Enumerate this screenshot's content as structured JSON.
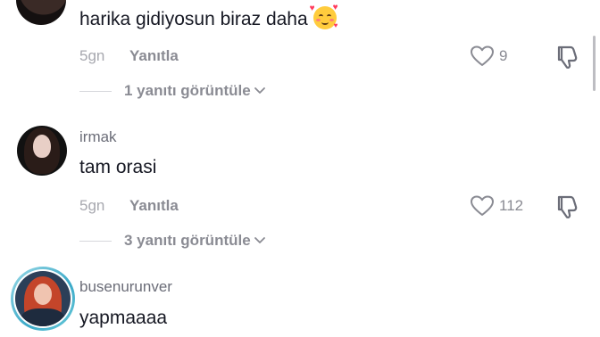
{
  "comments": [
    {
      "text": "harika gidiyosun biraz daha",
      "emoji": "smiling-face-with-hearts",
      "time": "5gn",
      "reply_label": "Yanıtla",
      "likes": "9",
      "view_replies": "1 yanıtı görüntüle"
    },
    {
      "username": "irmak",
      "text": "tam orasi",
      "time": "5gn",
      "reply_label": "Yanıtla",
      "likes": "112",
      "view_replies": "3 yanıtı görüntüle"
    },
    {
      "username": "busenurunver",
      "text": "yapmaaaa"
    }
  ],
  "icons": {
    "like": "heart-outline-icon",
    "dislike": "thumbs-down-icon",
    "expand": "chevron-down-icon"
  },
  "colors": {
    "text_primary": "#161823",
    "text_secondary": "#8a8b93",
    "ring_accent": "#3aa9c8"
  }
}
